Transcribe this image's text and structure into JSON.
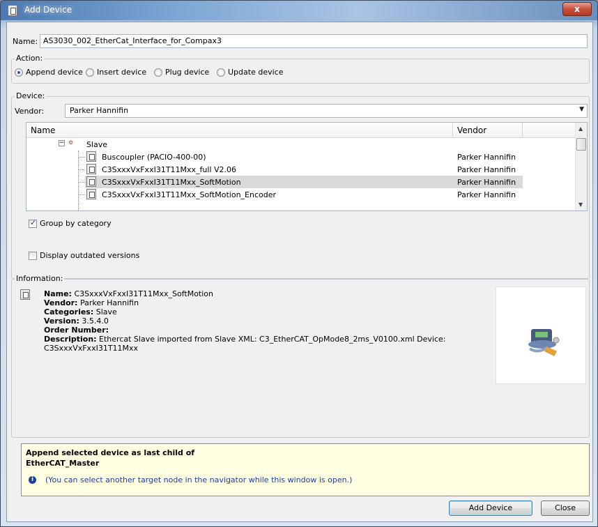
{
  "window": {
    "title": "Add Device",
    "close_glyph": "x"
  },
  "name_field": {
    "label": "Name:",
    "value": "AS3030_002_EtherCat_Interface_for_Compax3"
  },
  "action": {
    "group_label": "Action:",
    "options": [
      {
        "label": "Append device",
        "selected": true
      },
      {
        "label": "Insert device",
        "selected": false
      },
      {
        "label": "Plug device",
        "selected": false
      },
      {
        "label": "Update device",
        "selected": false
      }
    ]
  },
  "device": {
    "group_label": "Device:",
    "vendor_label": "Vendor:",
    "vendor_value": "Parker Hannifin",
    "columns": [
      "Name",
      "Vendor"
    ],
    "category": {
      "label": "Slave",
      "icon": "ethercat-slave-icon"
    },
    "rows": [
      {
        "name": "Buscoupler (PACIO-400-00)",
        "vendor": "Parker Hannifin",
        "selected": false
      },
      {
        "name": "C3SxxxVxFxxI31T11Mxx_full V2.06",
        "vendor": "Parker Hannifin",
        "selected": false
      },
      {
        "name": "C3SxxxVxFxxI31T11Mxx_SoftMotion",
        "vendor": "Parker Hannifin",
        "selected": true
      },
      {
        "name": "C3SxxxVxFxxI31T11Mxx_SoftMotion_Encoder",
        "vendor": "Parker Hannifin",
        "selected": false
      }
    ],
    "group_by_category": {
      "label": "Group by category",
      "checked": true
    },
    "display_outdated": {
      "label": "Display outdated versions",
      "checked": false
    }
  },
  "information": {
    "group_label": "Information:",
    "name_key": "Name:",
    "name_val": "C3SxxxVxFxxI31T11Mxx_SoftMotion",
    "vendor_key": "Vendor:",
    "vendor_val": "Parker Hannifin",
    "categories_key": "Categories:",
    "categories_val": "Slave",
    "version_key": "Version:",
    "version_val": "3.5.4.0",
    "order_key": "Order Number:",
    "order_val": "",
    "description_key": "Description:",
    "description_val": "Ethercat Slave imported from Slave XML: C3_EtherCAT_OpMode8_2ms_V0100.xml Device:",
    "description_val2": "C3SxxxVxFxxI31T11Mxx"
  },
  "hint": {
    "line1": "Append selected device as last child of",
    "line2": "EtherCAT_Master",
    "note": "(You can select another target node in the navigator while this window is open.)",
    "info_glyph": "i"
  },
  "buttons": {
    "add": "Add Device",
    "close": "Close"
  }
}
